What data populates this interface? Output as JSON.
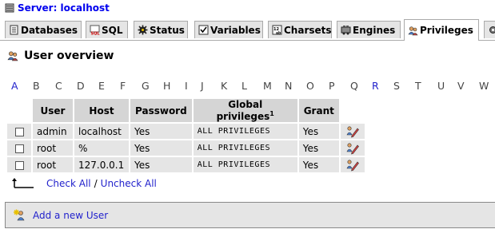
{
  "server": {
    "label": "Server: localhost"
  },
  "tabs": [
    {
      "label": "Databases",
      "icon": "databases-icon"
    },
    {
      "label": "SQL",
      "icon": "sql-icon"
    },
    {
      "label": "Status",
      "icon": "status-icon"
    },
    {
      "label": "Variables",
      "icon": "variables-icon"
    },
    {
      "label": "Charsets",
      "icon": "charsets-icon"
    },
    {
      "label": "Engines",
      "icon": "engines-icon"
    },
    {
      "label": "Privileges",
      "icon": "privileges-icon",
      "active": true
    }
  ],
  "title": "User overview",
  "alphabet": [
    "A",
    "B",
    "C",
    "D",
    "E",
    "F",
    "G",
    "H",
    "I",
    "J",
    "K",
    "L",
    "M",
    "N",
    "O",
    "P",
    "Q",
    "R",
    "S",
    "T",
    "U",
    "V",
    "W"
  ],
  "alphabet_links": [
    "A",
    "R"
  ],
  "table": {
    "headers": {
      "user": "User",
      "host": "Host",
      "password": "Password",
      "global": "Global privileges",
      "global_note": "1",
      "grant": "Grant"
    },
    "rows": [
      {
        "user": "admin",
        "host": "localhost",
        "password": "Yes",
        "global": "ALL PRIVILEGES",
        "grant": "Yes"
      },
      {
        "user": "root",
        "host": "%",
        "password": "Yes",
        "global": "ALL PRIVILEGES",
        "grant": "Yes"
      },
      {
        "user": "root",
        "host": "127.0.0.1",
        "password": "Yes",
        "global": "ALL PRIVILEGES",
        "grant": "Yes"
      }
    ]
  },
  "check_all": "Check All",
  "separator": "/",
  "uncheck_all": "Uncheck All",
  "add_user": "Add a new User",
  "colors": {
    "link": "#2222cc",
    "header_bg": "#d5d5d5",
    "row_bg": "#e5e5e5"
  }
}
